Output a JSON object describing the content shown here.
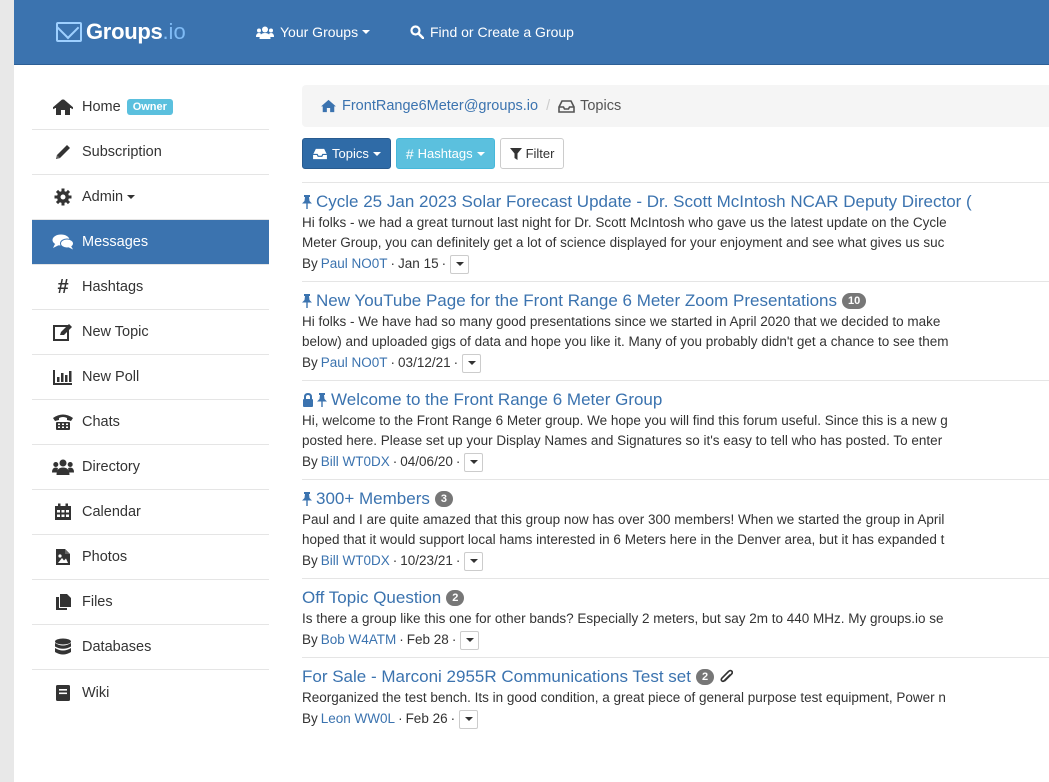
{
  "navbar": {
    "brand_name": "Groups",
    "brand_tld": ".io",
    "your_groups": "Your Groups",
    "find_group": "Find or Create a Group"
  },
  "sidebar": {
    "items": [
      {
        "label": "Home",
        "icon": "home-icon",
        "badge": "Owner"
      },
      {
        "label": "Subscription",
        "icon": "pencil-icon"
      },
      {
        "label": "Admin",
        "icon": "gear-icon"
      },
      {
        "label": "Messages",
        "icon": "comments-icon"
      },
      {
        "label": "Hashtags",
        "icon": "hashtag-icon"
      },
      {
        "label": "New Topic",
        "icon": "edit-icon"
      },
      {
        "label": "New Poll",
        "icon": "poll-icon"
      },
      {
        "label": "Chats",
        "icon": "phone-icon"
      },
      {
        "label": "Directory",
        "icon": "users-icon"
      },
      {
        "label": "Calendar",
        "icon": "calendar-icon"
      },
      {
        "label": "Photos",
        "icon": "photo-icon"
      },
      {
        "label": "Files",
        "icon": "files-icon"
      },
      {
        "label": "Databases",
        "icon": "database-icon"
      },
      {
        "label": "Wiki",
        "icon": "book-icon"
      }
    ]
  },
  "breadcrumb": {
    "group": "FrontRange6Meter@groups.io",
    "current": "Topics"
  },
  "toolbar": {
    "topics": "Topics",
    "hashtags": "Hashtags",
    "filter": "Filter"
  },
  "topics": [
    {
      "title": "Cycle 25 Jan 2023 Solar Forecast Update - Dr. Scott McIntosh NCAR Deputy Director (",
      "line1": "Hi folks - we had a great turnout last night for Dr. Scott McIntosh who gave us the latest update on the Cycle",
      "line2": "Meter Group, you can definitely get a lot of science displayed for your enjoyment and see what gives us suc",
      "author": "Paul NO0T",
      "date": "Jan 15",
      "count": ""
    },
    {
      "title": "New YouTube Page for the Front Range 6 Meter Zoom Presentations",
      "line1": "Hi folks - We have had so many good presentations since we started in April 2020 that we decided to make",
      "line2": "below) and uploaded gigs of data and hope you like it. Many of you probably didn't get a chance to see them",
      "author": "Paul NO0T",
      "date": "03/12/21",
      "count": "10"
    },
    {
      "title": "Welcome to the Front Range 6 Meter Group",
      "line1": "Hi, welcome to the Front Range 6 Meter group. We hope you will find this forum useful. Since this is a new g",
      "line2": "posted here. Please set up your Display Names and Signatures so it's easy to tell who has posted. To enter",
      "author": "Bill WT0DX",
      "date": "04/06/20",
      "count": ""
    },
    {
      "title": "300+ Members",
      "line1": "Paul and I are quite amazed that this group now has over 300 members! When we started the group in April",
      "line2": "hoped that it would support local hams interested in 6 Meters here in the Denver area, but it has expanded t",
      "author": "Bill WT0DX",
      "date": "10/23/21",
      "count": "3"
    },
    {
      "title": "Off Topic Question",
      "line1": "Is there a group like this one for other bands? Especially 2 meters, but say 2m to 440 MHz. My groups.io se",
      "line2": "",
      "author": "Bob W4ATM",
      "date": "Feb 28",
      "count": "2"
    },
    {
      "title": "For Sale - Marconi 2955R Communications Test set",
      "line1": "Reorganized the test bench. Its in good condition, a great piece of general purpose test equipment, Power n",
      "line2": "",
      "author": "Leon WW0L",
      "date": "Feb 26",
      "count": "2"
    }
  ],
  "labels": {
    "by": "By",
    "dot": "·"
  }
}
